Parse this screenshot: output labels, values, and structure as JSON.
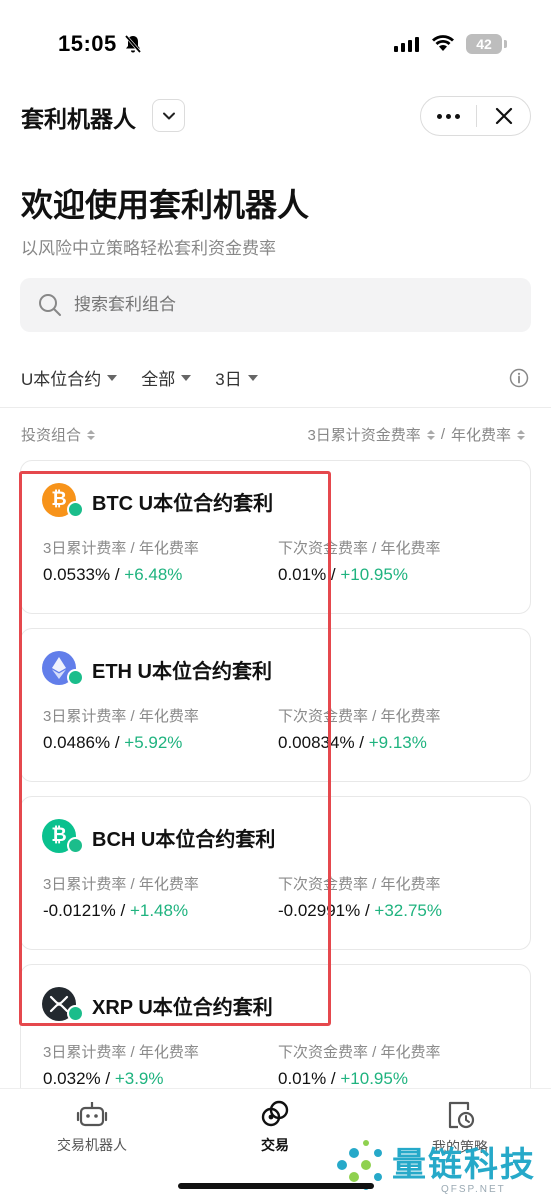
{
  "status_bar": {
    "time": "15:05",
    "battery": "42"
  },
  "header": {
    "title": "套利机器人"
  },
  "hero": {
    "title": "欢迎使用套利机器人",
    "subtitle": "以风险中立策略轻松套利资金费率"
  },
  "search": {
    "placeholder": "搜索套利组合"
  },
  "filters": {
    "contract_type": "U本位合约",
    "scope": "全部",
    "period": "3日"
  },
  "columns": {
    "left": "投资组合",
    "right_a": "3日累计资金费率",
    "slash": "/",
    "right_b": "年化费率"
  },
  "cards": [
    {
      "coin": "BTC",
      "title": "BTC U本位合约套利",
      "color": "#f7931a",
      "left_label": "3日累计费率 / 年化费率",
      "left_value": "0.0533% / ",
      "left_yield": "+6.48%",
      "right_label": "下次资金费率 / 年化费率",
      "right_value": "0.01% / ",
      "right_yield": "+10.95%"
    },
    {
      "coin": "ETH",
      "title": "ETH U本位合约套利",
      "color": "#627eea",
      "left_label": "3日累计费率 / 年化费率",
      "left_value": "0.0486% / ",
      "left_yield": "+5.92%",
      "right_label": "下次资金费率 / 年化费率",
      "right_value": "0.00834% / ",
      "right_yield": "+9.13%"
    },
    {
      "coin": "BCH",
      "title": "BCH U本位合约套利",
      "color": "#0ac18e",
      "left_label": "3日累计费率 / 年化费率",
      "left_value": "-0.0121% / ",
      "left_yield": "+1.48%",
      "right_label": "下次资金费率 / 年化费率",
      "right_value": "-0.02991% / ",
      "right_yield": "+32.75%"
    },
    {
      "coin": "XRP",
      "title": "XRP U本位合约套利",
      "color": "#23292f",
      "left_label": "3日累计费率 / 年化费率",
      "left_value": "0.032% / ",
      "left_yield": "+3.9%",
      "right_label": "下次资金费率 / 年化费率",
      "right_value": "0.01% / ",
      "right_yield": "+10.95%"
    }
  ],
  "bottom_nav": [
    {
      "label": "交易机器人"
    },
    {
      "label": "交易"
    },
    {
      "label": "我的策略"
    }
  ],
  "watermark": {
    "text": "量链科技",
    "sub": "QFSP.NET"
  },
  "colors": {
    "positive": "#1fb37f",
    "highlight": "#e5484d",
    "watermark": "#26a9c9"
  }
}
